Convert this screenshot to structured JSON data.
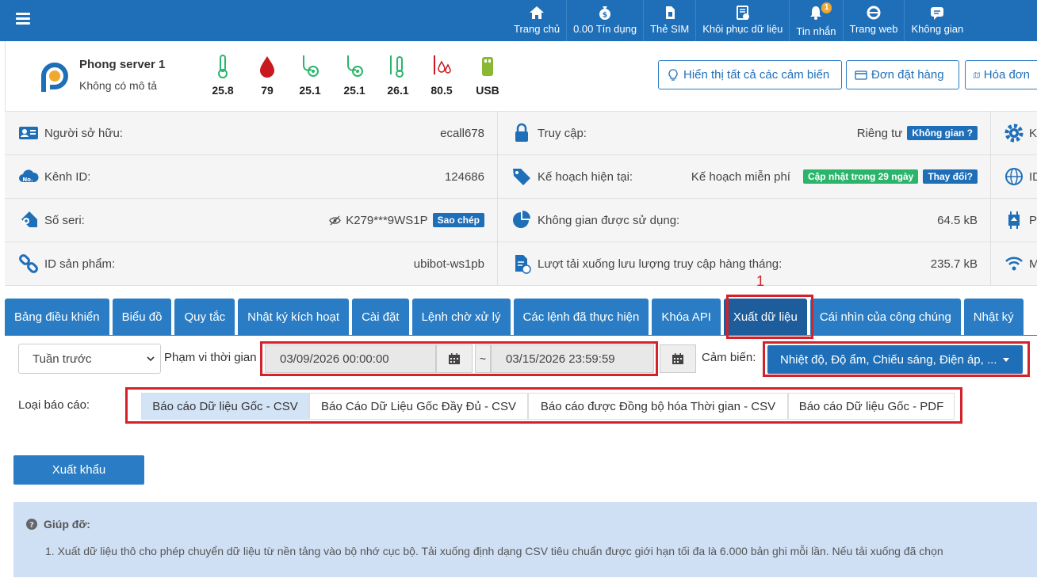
{
  "nav": {
    "items": [
      {
        "label": "Trang chủ",
        "icon": "home-icon"
      },
      {
        "label": "0.00 Tín dụng",
        "icon": "money-bag-icon"
      },
      {
        "label": "Thẻ SIM",
        "icon": "sim-card-icon"
      },
      {
        "label": "Khôi phục dữ liệu",
        "icon": "restore-icon"
      },
      {
        "label": "Tin nhắn",
        "icon": "bell-icon",
        "badge": "1"
      },
      {
        "label": "Trang web",
        "icon": "web-icon"
      },
      {
        "label": "Không gian",
        "icon": "chat-icon"
      }
    ]
  },
  "device": {
    "name": "Phong server 1",
    "description": "Không có mô tả",
    "sensors": [
      {
        "icon": "thermometer-icon",
        "value": "25.8",
        "color": "#2bb56b"
      },
      {
        "icon": "humidity-drop-icon",
        "value": "79",
        "color": "#d3222a"
      },
      {
        "icon": "probe-icon",
        "value": "25.1",
        "color": "#2bb56b"
      },
      {
        "icon": "probe-icon",
        "value": "25.1",
        "color": "#2bb56b"
      },
      {
        "icon": "probe-thermo-icon",
        "value": "26.1",
        "color": "#2bb56b"
      },
      {
        "icon": "probe-humidity-icon",
        "value": "80.5",
        "color": "#d3222a"
      },
      {
        "icon": "usb-icon",
        "value": "USB",
        "color": "#8ab833"
      }
    ],
    "buttons": {
      "show_sensors": "Hiển thị tất cả các cảm biến",
      "orders": "Đơn đặt hàng",
      "invoice": "Hóa đơn"
    }
  },
  "info": {
    "owner_label": "Người sở hữu:",
    "owner_value": "ecall678",
    "channel_label": "Kênh ID:",
    "channel_value": "124686",
    "serial_label": "Số seri:",
    "serial_value": "K279***9WS1P",
    "serial_copy": "Sao chép",
    "product_label": "ID sản phẩm:",
    "product_value": "ubibot-ws1pb",
    "access_label": "Truy cập:",
    "access_value": "Riêng tư",
    "access_tag": "Không gian ?",
    "plan_label": "Kế hoạch hiện tại:",
    "plan_value": "Kế hoạch miễn phí",
    "plan_tag": "Cập nhật trong 29 ngày",
    "plan_change": "Thay đổi?",
    "space_label": "Không gian được sử dụng:",
    "space_value": "64.5 kB",
    "traffic_label": "Lượt tải xuống lưu lượng truy cập hàng tháng:",
    "traffic_value": "235.7 kB",
    "col3": [
      "K",
      "ID",
      "P",
      "M"
    ]
  },
  "tabs": [
    "Bảng điều khiển",
    "Biểu đồ",
    "Quy tắc",
    "Nhật ký kích hoạt",
    "Cài đặt",
    "Lệnh chờ xử lý",
    "Các lệnh đã thực hiện",
    "Khóa API",
    "Xuất dữ liệu",
    "Cái nhìn của công chúng",
    "Nhật ký"
  ],
  "annotation_marker": "1",
  "filter": {
    "period": "Tuần trước",
    "range_label": "Phạm vi thời gian",
    "start": "03/09/2026 00:00:00",
    "tilde": "~",
    "end": "03/15/2026 23:59:59",
    "sensor_label": "Cảm biến:",
    "sensor_value": "Nhiệt độ, Độ ẩm, Chiếu sáng, Điện áp, ..."
  },
  "report": {
    "label": "Loại báo cáo:",
    "types": [
      "Báo cáo Dữ liệu Gốc - CSV",
      "Báo Cáo Dữ Liệu Gốc Đầy Đủ - CSV",
      "Báo cáo được Đồng bộ hóa Thời gian - CSV",
      "Báo cáo Dữ liệu Gốc - PDF"
    ]
  },
  "export_label": "Xuất khẩu",
  "help": {
    "title": "Giúp đỡ:",
    "text": "1. Xuất dữ liệu thô cho phép chuyển dữ liệu từ nền tảng vào bộ nhớ cục bộ. Tải xuống định dạng CSV tiêu chuẩn được giới hạn tối đa là 6.000 bản ghi mỗi lần. Nếu tải xuống đã chọn"
  }
}
